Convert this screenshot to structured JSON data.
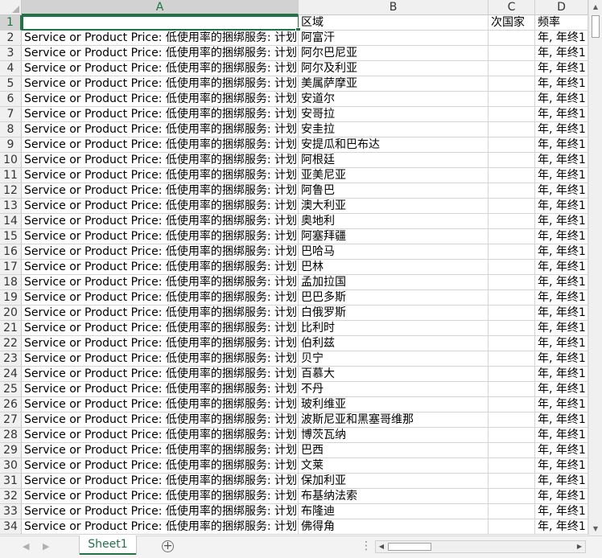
{
  "columns": [
    "A",
    "B",
    "C",
    "D"
  ],
  "header_row": {
    "row": "1",
    "a": "",
    "b": "区域",
    "c": "次国家",
    "d": "频率"
  },
  "data_rows": [
    {
      "row": "2",
      "a": "Service or Product Price:  低使用率的捆绑服务: 计划",
      "b": "阿富汗",
      "c": "",
      "d": "年, 年终1"
    },
    {
      "row": "3",
      "a": "Service or Product Price:  低使用率的捆绑服务: 计划",
      "b": "阿尔巴尼亚",
      "c": "",
      "d": "年, 年终1"
    },
    {
      "row": "4",
      "a": "Service or Product Price:  低使用率的捆绑服务: 计划",
      "b": "阿尔及利亚",
      "c": "",
      "d": "年, 年终1"
    },
    {
      "row": "5",
      "a": "Service or Product Price:  低使用率的捆绑服务: 计划",
      "b": "美属萨摩亚",
      "c": "",
      "d": "年, 年终1"
    },
    {
      "row": "6",
      "a": "Service or Product Price:  低使用率的捆绑服务: 计划",
      "b": "安道尔",
      "c": "",
      "d": "年, 年终1"
    },
    {
      "row": "7",
      "a": "Service or Product Price:  低使用率的捆绑服务: 计划",
      "b": "安哥拉",
      "c": "",
      "d": "年, 年终1"
    },
    {
      "row": "8",
      "a": "Service or Product Price:  低使用率的捆绑服务: 计划",
      "b": "安圭拉",
      "c": "",
      "d": "年, 年终1"
    },
    {
      "row": "9",
      "a": "Service or Product Price:  低使用率的捆绑服务: 计划",
      "b": "安提瓜和巴布达",
      "c": "",
      "d": "年, 年终1"
    },
    {
      "row": "10",
      "a": "Service or Product Price:  低使用率的捆绑服务: 计划",
      "b": "阿根廷",
      "c": "",
      "d": "年, 年终1"
    },
    {
      "row": "11",
      "a": "Service or Product Price:  低使用率的捆绑服务: 计划",
      "b": "亚美尼亚",
      "c": "",
      "d": "年, 年终1"
    },
    {
      "row": "12",
      "a": "Service or Product Price:  低使用率的捆绑服务: 计划",
      "b": "阿鲁巴",
      "c": "",
      "d": "年, 年终1"
    },
    {
      "row": "13",
      "a": "Service or Product Price:  低使用率的捆绑服务: 计划",
      "b": "澳大利亚",
      "c": "",
      "d": "年, 年终1"
    },
    {
      "row": "14",
      "a": "Service or Product Price:  低使用率的捆绑服务: 计划",
      "b": "奥地利",
      "c": "",
      "d": "年, 年终1"
    },
    {
      "row": "15",
      "a": "Service or Product Price:  低使用率的捆绑服务: 计划",
      "b": "阿塞拜疆",
      "c": "",
      "d": "年, 年终1"
    },
    {
      "row": "16",
      "a": "Service or Product Price:  低使用率的捆绑服务: 计划",
      "b": "巴哈马",
      "c": "",
      "d": "年, 年终1"
    },
    {
      "row": "17",
      "a": "Service or Product Price:  低使用率的捆绑服务: 计划",
      "b": "巴林",
      "c": "",
      "d": "年, 年终1"
    },
    {
      "row": "18",
      "a": "Service or Product Price:  低使用率的捆绑服务: 计划",
      "b": "孟加拉国",
      "c": "",
      "d": "年, 年终1"
    },
    {
      "row": "19",
      "a": "Service or Product Price:  低使用率的捆绑服务: 计划",
      "b": "巴巴多斯",
      "c": "",
      "d": "年, 年终1"
    },
    {
      "row": "20",
      "a": "Service or Product Price:  低使用率的捆绑服务: 计划",
      "b": "白俄罗斯",
      "c": "",
      "d": "年, 年终1"
    },
    {
      "row": "21",
      "a": "Service or Product Price:  低使用率的捆绑服务: 计划",
      "b": "比利时",
      "c": "",
      "d": "年, 年终1"
    },
    {
      "row": "22",
      "a": "Service or Product Price:  低使用率的捆绑服务: 计划",
      "b": "伯利兹",
      "c": "",
      "d": "年, 年终1"
    },
    {
      "row": "23",
      "a": "Service or Product Price:  低使用率的捆绑服务: 计划",
      "b": "贝宁",
      "c": "",
      "d": "年, 年终1"
    },
    {
      "row": "24",
      "a": "Service or Product Price:  低使用率的捆绑服务: 计划",
      "b": "百慕大",
      "c": "",
      "d": "年, 年终1"
    },
    {
      "row": "25",
      "a": "Service or Product Price:  低使用率的捆绑服务: 计划",
      "b": "不丹",
      "c": "",
      "d": "年, 年终1"
    },
    {
      "row": "26",
      "a": "Service or Product Price:  低使用率的捆绑服务: 计划",
      "b": "玻利维亚",
      "c": "",
      "d": "年, 年终1"
    },
    {
      "row": "27",
      "a": "Service or Product Price:  低使用率的捆绑服务: 计划",
      "b": "波斯尼亚和黑塞哥维那",
      "c": "",
      "d": "年, 年终1"
    },
    {
      "row": "28",
      "a": "Service or Product Price:  低使用率的捆绑服务: 计划",
      "b": "博茨瓦纳",
      "c": "",
      "d": "年, 年终1"
    },
    {
      "row": "29",
      "a": "Service or Product Price:  低使用率的捆绑服务: 计划",
      "b": "巴西",
      "c": "",
      "d": "年, 年终1"
    },
    {
      "row": "30",
      "a": "Service or Product Price:  低使用率的捆绑服务: 计划",
      "b": "文莱",
      "c": "",
      "d": "年, 年终1"
    },
    {
      "row": "31",
      "a": "Service or Product Price:  低使用率的捆绑服务: 计划",
      "b": "保加利亚",
      "c": "",
      "d": "年, 年终1"
    },
    {
      "row": "32",
      "a": "Service or Product Price:  低使用率的捆绑服务: 计划",
      "b": "布基纳法索",
      "c": "",
      "d": "年, 年终1"
    },
    {
      "row": "33",
      "a": "Service or Product Price:  低使用率的捆绑服务: 计划",
      "b": "布隆迪",
      "c": "",
      "d": "年, 年终1"
    },
    {
      "row": "34",
      "a": "Service or Product Price:  低使用率的捆绑服务: 计划",
      "b": "佛得角",
      "c": "",
      "d": "年, 年终1"
    }
  ],
  "sheet_tab": "Sheet1",
  "add_sheet_symbol": "+",
  "more_symbol": "⋮",
  "colors": {
    "accent": "#217346",
    "header_bg": "#f0f0f0",
    "gridline": "#d4d4d4"
  }
}
